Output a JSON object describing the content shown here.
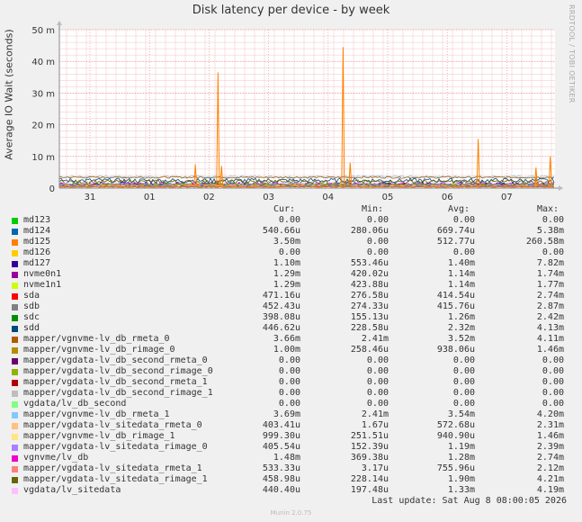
{
  "chart_data": {
    "type": "line",
    "title": "Disk latency per device - by week",
    "ylabel": "Average IO Wait (seconds)",
    "ylim": [
      0,
      0.05
    ],
    "y_ticks": [
      {
        "value": 0,
        "label": "0"
      },
      {
        "value": 0.01,
        "label": "10 m"
      },
      {
        "value": 0.02,
        "label": "20 m"
      },
      {
        "value": 0.03,
        "label": "30 m"
      },
      {
        "value": 0.04,
        "label": "40 m"
      },
      {
        "value": 0.05,
        "label": "50 m"
      }
    ],
    "x_ticks": [
      "31",
      "01",
      "02",
      "03",
      "04",
      "05",
      "06",
      "07"
    ],
    "grid": true,
    "series": [
      {
        "name": "md125",
        "spikes": [
          {
            "day": 1.77,
            "value": 0.0075
          },
          {
            "day": 2.15,
            "value": 0.0365
          },
          {
            "day": 2.21,
            "value": 0.007
          },
          {
            "day": 4.25,
            "value": 0.0445
          },
          {
            "day": 4.37,
            "value": 0.008
          },
          {
            "day": 6.52,
            "value": 0.0155
          },
          {
            "day": 7.49,
            "value": 0.0065
          },
          {
            "day": 7.73,
            "value": 0.01
          }
        ]
      }
    ]
  },
  "watermark": "RRDTOOL / TOBI OETIKER",
  "legend_headers": {
    "cur": "Cur:",
    "min": "Min:",
    "avg": "Avg:",
    "max": "Max:"
  },
  "legend": [
    {
      "name": "md123",
      "color": "#00cc00",
      "cur": "0.00",
      "min": "0.00",
      "avg": "0.00",
      "max": "0.00"
    },
    {
      "name": "md124",
      "color": "#0066b3",
      "cur": "540.66u",
      "min": "280.06u",
      "avg": "669.74u",
      "max": "5.38m"
    },
    {
      "name": "md125",
      "color": "#ff8000",
      "cur": "3.50m",
      "min": "0.00",
      "avg": "512.77u",
      "max": "260.58m"
    },
    {
      "name": "md126",
      "color": "#ffcc00",
      "cur": "0.00",
      "min": "0.00",
      "avg": "0.00",
      "max": "0.00"
    },
    {
      "name": "md127",
      "color": "#330099",
      "cur": "1.10m",
      "min": "553.46u",
      "avg": "1.40m",
      "max": "7.82m"
    },
    {
      "name": "nvme0n1",
      "color": "#990099",
      "cur": "1.29m",
      "min": "420.02u",
      "avg": "1.14m",
      "max": "1.74m"
    },
    {
      "name": "nvme1n1",
      "color": "#ccff00",
      "cur": "1.29m",
      "min": "423.88u",
      "avg": "1.14m",
      "max": "1.77m"
    },
    {
      "name": "sda",
      "color": "#ff0000",
      "cur": "471.16u",
      "min": "276.58u",
      "avg": "414.54u",
      "max": "2.74m"
    },
    {
      "name": "sdb",
      "color": "#808080",
      "cur": "452.43u",
      "min": "274.33u",
      "avg": "415.76u",
      "max": "2.87m"
    },
    {
      "name": "sdc",
      "color": "#008f00",
      "cur": "398.08u",
      "min": "155.13u",
      "avg": "1.26m",
      "max": "2.42m"
    },
    {
      "name": "sdd",
      "color": "#00487d",
      "cur": "446.62u",
      "min": "228.58u",
      "avg": "2.32m",
      "max": "4.13m"
    },
    {
      "name": "mapper/vgnvme-lv_db_rmeta_0",
      "color": "#b35a00",
      "cur": "3.66m",
      "min": "2.41m",
      "avg": "3.52m",
      "max": "4.11m"
    },
    {
      "name": "mapper/vgnvme-lv_db_rimage_0",
      "color": "#b38f00",
      "cur": "1.00m",
      "min": "258.46u",
      "avg": "938.06u",
      "max": "1.46m"
    },
    {
      "name": "mapper/vgdata-lv_db_second_rmeta_0",
      "color": "#6b006b",
      "cur": "0.00",
      "min": "0.00",
      "avg": "0.00",
      "max": "0.00"
    },
    {
      "name": "mapper/vgdata-lv_db_second_rimage_0",
      "color": "#8fb300",
      "cur": "0.00",
      "min": "0.00",
      "avg": "0.00",
      "max": "0.00"
    },
    {
      "name": "mapper/vgdata-lv_db_second_rmeta_1",
      "color": "#b30000",
      "cur": "0.00",
      "min": "0.00",
      "avg": "0.00",
      "max": "0.00"
    },
    {
      "name": "mapper/vgdata-lv_db_second_rimage_1",
      "color": "#bebebe",
      "cur": "0.00",
      "min": "0.00",
      "avg": "0.00",
      "max": "0.00"
    },
    {
      "name": "vgdata/lv_db_second",
      "color": "#80ff80",
      "cur": "0.00",
      "min": "0.00",
      "avg": "0.00",
      "max": "0.00"
    },
    {
      "name": "mapper/vgnvme-lv_db_rmeta_1",
      "color": "#80c9ff",
      "cur": "3.69m",
      "min": "2.41m",
      "avg": "3.54m",
      "max": "4.20m"
    },
    {
      "name": "mapper/vgdata-lv_sitedata_rmeta_0",
      "color": "#ffc080",
      "cur": "403.41u",
      "min": "1.67u",
      "avg": "572.68u",
      "max": "2.31m"
    },
    {
      "name": "mapper/vgnvme-lv_db_rimage_1",
      "color": "#ffe680",
      "cur": "999.30u",
      "min": "251.51u",
      "avg": "940.90u",
      "max": "1.46m"
    },
    {
      "name": "mapper/vgdata-lv_sitedata_rimage_0",
      "color": "#aa80ff",
      "cur": "405.54u",
      "min": "152.39u",
      "avg": "1.19m",
      "max": "2.39m"
    },
    {
      "name": "vgnvme/lv_db",
      "color": "#ee00cc",
      "cur": "1.48m",
      "min": "369.38u",
      "avg": "1.28m",
      "max": "2.74m"
    },
    {
      "name": "mapper/vgdata-lv_sitedata_rmeta_1",
      "color": "#ff8080",
      "cur": "533.33u",
      "min": "3.17u",
      "avg": "755.96u",
      "max": "2.12m"
    },
    {
      "name": "mapper/vgdata-lv_sitedata_rimage_1",
      "color": "#666600",
      "cur": "458.98u",
      "min": "228.14u",
      "avg": "1.90m",
      "max": "4.21m"
    },
    {
      "name": "vgdata/lv_sitedata",
      "color": "#ffbfff",
      "cur": "440.40u",
      "min": "197.48u",
      "avg": "1.33m",
      "max": "4.19m"
    }
  ],
  "last_update": "Last update: Sat Aug  8 08:00:05 2026",
  "footer": "Munin 2.0.75"
}
